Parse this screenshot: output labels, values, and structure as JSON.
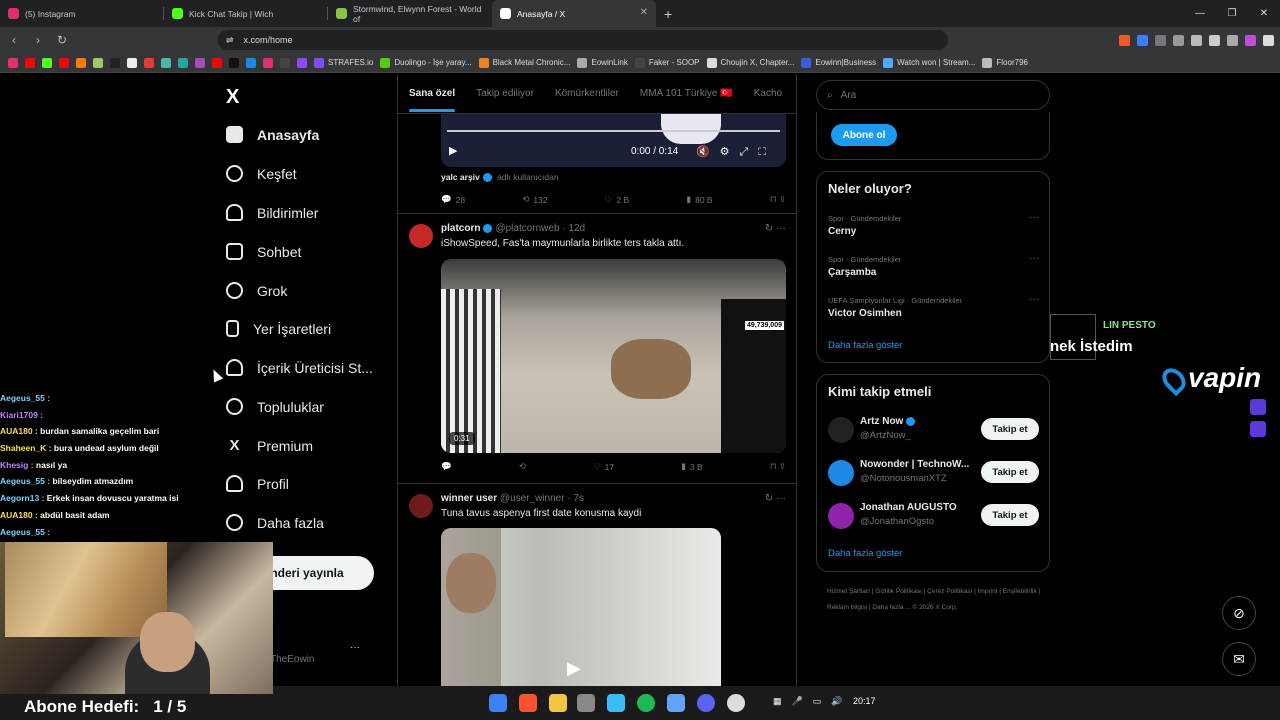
{
  "browser": {
    "tabs": [
      {
        "title": "(5) Instagram",
        "color": "#e1306c"
      },
      {
        "title": "Kick Chat Takip | Wich",
        "color": "#53fc18"
      },
      {
        "title": "Stormwind, Elwynn Forest - World of",
        "color": "#8bc34a"
      },
      {
        "title": "Anasayfa / X",
        "color": "#ffffff"
      }
    ],
    "new_tab": "+",
    "url": "x.com/home",
    "window_controls": [
      "—",
      "❐",
      "✕"
    ],
    "bookmarks": [
      {
        "label": "STRAFES.io",
        "color": "#7b4dff"
      },
      {
        "label": "Duolingo - İşe yaray...",
        "color": "#58cc02"
      },
      {
        "label": "Black Metal Chronic...",
        "color": "#f48120"
      },
      {
        "label": "EowinLink",
        "color": "#aaaaaa"
      },
      {
        "label": "Faker - SOOP",
        "color": "#444444"
      },
      {
        "label": "Choujin X, Chapter...",
        "color": "#dddddd"
      },
      {
        "label": "Eowinn|Business",
        "color": "#3b5bdb"
      },
      {
        "label": "Watch won | Stream...",
        "color": "#4dabf7"
      },
      {
        "label": "Floor796",
        "color": "#bbbbbb"
      }
    ]
  },
  "sidebar": {
    "logo": "X",
    "items": [
      {
        "label": "Anasayfa",
        "icon": "home-icon"
      },
      {
        "label": "Keşfet",
        "icon": "search-icon"
      },
      {
        "label": "Bildirimler",
        "icon": "bell-icon"
      },
      {
        "label": "Sohbet",
        "icon": "mail-icon"
      },
      {
        "label": "Grok",
        "icon": "grok-icon"
      },
      {
        "label": "Yer İşaretleri",
        "icon": "bookmark-icon"
      },
      {
        "label": "İçerik Üreticisi St...",
        "icon": "creator-icon"
      },
      {
        "label": "Topluluklar",
        "icon": "communities-icon"
      },
      {
        "label": "Premium",
        "icon": "x-icon"
      },
      {
        "label": "Profil",
        "icon": "profile-icon"
      },
      {
        "label": "Daha fazla",
        "icon": "more-icon"
      }
    ],
    "post_button": "nderi yayınla",
    "account_handle": "TheEowin",
    "account_more": "···"
  },
  "feed": {
    "tabs": [
      "Sana özel",
      "Takip ediliyor",
      "Kömürkentliler",
      "MMA 101 Türkiye 🇹🇷",
      "Kacho"
    ],
    "video_time": "0:00 / 0:14",
    "post0": {
      "source_name": "yalc arşiv",
      "source_suffix": "adlı kullanıcıdan",
      "replies": "28",
      "reposts": "132",
      "likes": "2 B",
      "views": "80 B"
    },
    "posts": [
      {
        "name": "platcorn",
        "handle": "@platcornweb · 12d",
        "text": "iShowSpeed, Fas'ta maymunlarla birlikte ters takla attı.",
        "duration": "0:31",
        "view_overlay": "49,739,009",
        "replies": "",
        "reposts": "",
        "likes": "17",
        "views": "3 B"
      },
      {
        "name": "winner user",
        "handle": "@user_winner · 7s",
        "text": "Tuna tavus aspenya first date konusma kaydi"
      }
    ]
  },
  "right": {
    "search_placeholder": "Ara",
    "subscribe_button": "Abone ol",
    "trends_title": "Neler oluyor?",
    "trends": [
      {
        "category": "Spor · Gündemdekiler",
        "name": "Cerny"
      },
      {
        "category": "Spor · Gündemdekiler",
        "name": "Çarşamba"
      },
      {
        "category": "UEFA Şampiyonlar Ligi · Gündemdekiler",
        "name": "Victor Osimhen"
      }
    ],
    "show_more": "Daha fazla göster",
    "who_title": "Kimi takip etmeli",
    "who": [
      {
        "name": "Artz Now",
        "handle": "@ArtzNow_",
        "color": "#222222"
      },
      {
        "name": "Nowonder | TechnoW...",
        "handle": "@NotoriousmanXTZ",
        "color": "#1e88e5"
      },
      {
        "name": "Jonathan AUGUSTO",
        "handle": "@JonathanOgsto",
        "color": "#8e24aa"
      }
    ],
    "follow_label": "Takip et",
    "footer": "Hizmet Şartları | Gizlilik Politikası | Çerez Politikası | Imprint | Erişilebilirlik | Reklam bilgisi | Daha fazla ... © 2026 X Corp."
  },
  "stream": {
    "chat": [
      {
        "user": "Aegeus_55 :",
        "msg": "",
        "color": "#7dd3fc"
      },
      {
        "user": "Kiari1709 :",
        "msg": "",
        "color": "#c084fc"
      },
      {
        "user": "AUA180 :",
        "msg": "burdan samalika geçelim bari",
        "color": "#fde047"
      },
      {
        "user": "Shaheen_K :",
        "msg": "bura undead asylum değil",
        "color": "#fde047"
      },
      {
        "user": "Khesig :",
        "msg": "nasıl ya",
        "color": "#c084fc"
      },
      {
        "user": "Aegeus_55 :",
        "msg": "bilseydim atmazdım",
        "color": "#7dd3fc"
      },
      {
        "user": "Aegorn13 :",
        "msg": "Erkek insan dovuscu yaratma isi",
        "color": "#7dd3fc"
      },
      {
        "user": "AUA180 :",
        "msg": "abdül basit adam",
        "color": "#fde047"
      },
      {
        "user": "Aegeus_55 :",
        "msg": "",
        "color": "#7dd3fc"
      }
    ],
    "goal_label": "Abone Hedefi:",
    "goal_value": "1 / 5",
    "alert_title": "LIN PESTO",
    "alert_text": "nek İstedim",
    "sponsor": "vapin"
  },
  "taskbar": {
    "clock": "20:17"
  }
}
